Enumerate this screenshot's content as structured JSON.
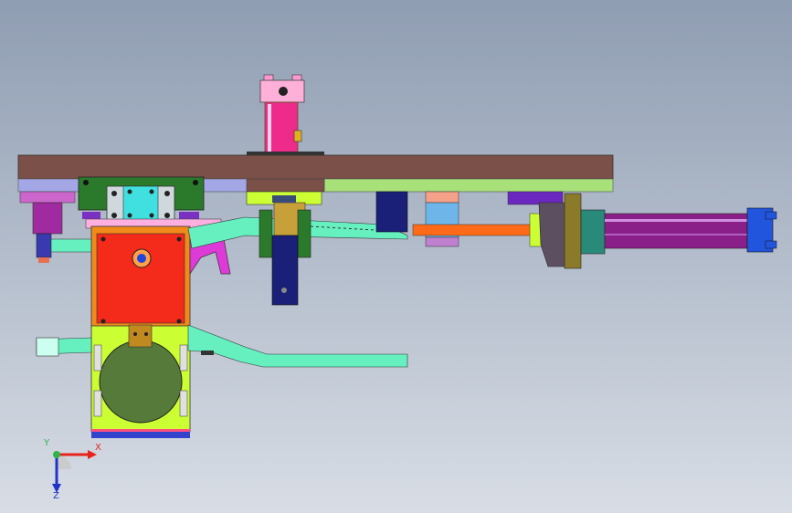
{
  "viewport": {
    "background_top": "#8f9db2",
    "background_bottom": "#d8dde5"
  },
  "triad": {
    "x_label": "X",
    "y_label": "Y",
    "z_label": "Z",
    "x_color": "#e8231b",
    "y_color": "#2fb24a",
    "z_color": "#2233cc"
  },
  "model": {
    "part_colors": {
      "base_plate": "#7a5048",
      "rail_green": "#a8e07a",
      "bracket_green": "#2b7a2b",
      "mount_cyan": "#40e0e0",
      "housing_orange": "#f08a1a",
      "housing_red": "#f42a1a",
      "body_yellow_green": "#ccff33",
      "disc_olive": "#557a3a",
      "cylinder_magenta": "#8a1f8a",
      "cylinder_end_blue": "#2255dd",
      "vertical_cylinder_pink": "#ee2a8a",
      "arm_teal": "#33e0b0",
      "clamp_magenta": "#dd3ad8",
      "navy_block": "#1a1f77",
      "rod_orange": "#ff6a18"
    }
  }
}
